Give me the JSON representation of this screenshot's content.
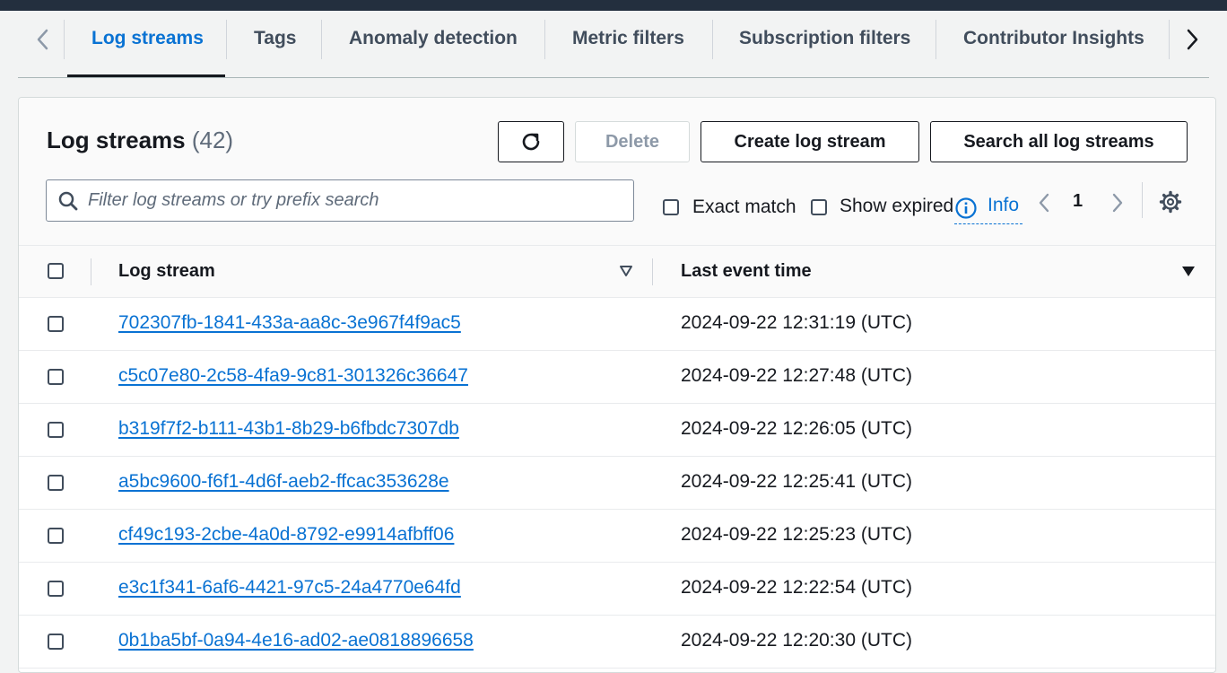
{
  "tabs": {
    "items": [
      "Log streams",
      "Tags",
      "Anomaly detection",
      "Metric filters",
      "Subscription filters",
      "Contributor Insights"
    ],
    "active": "Log streams"
  },
  "panel": {
    "title": "Log streams",
    "count": "(42)",
    "delete_label": "Delete",
    "create_label": "Create log stream",
    "search_all_label": "Search all log streams",
    "filter_placeholder": "Filter log streams or try prefix search",
    "exact_match_label": "Exact match",
    "show_expired_label": "Show expired",
    "info_label": "Info",
    "page": "1"
  },
  "table": {
    "columns": [
      "Log stream",
      "Last event time"
    ],
    "rows": [
      {
        "stream": "702307fb-1841-433a-aa8c-3e967f4f9ac5",
        "time": "2024-09-22 12:31:19 (UTC)"
      },
      {
        "stream": "c5c07e80-2c58-4fa9-9c81-301326c36647",
        "time": "2024-09-22 12:27:48 (UTC)"
      },
      {
        "stream": "b319f7f2-b111-43b1-8b29-b6fbdc7307db",
        "time": "2024-09-22 12:26:05 (UTC)"
      },
      {
        "stream": "a5bc9600-f6f1-4d6f-aeb2-ffcac353628e",
        "time": "2024-09-22 12:25:41 (UTC)"
      },
      {
        "stream": "cf49c193-2cbe-4a0d-8792-e9914afbff06",
        "time": "2024-09-22 12:25:23 (UTC)"
      },
      {
        "stream": "e3c1f341-6af6-4421-97c5-24a4770e64fd",
        "time": "2024-09-22 12:22:54 (UTC)"
      },
      {
        "stream": "0b1ba5bf-0a94-4e16-ad02-ae0818896658",
        "time": "2024-09-22 12:20:30 (UTC)"
      }
    ]
  },
  "icons": {
    "tab_prev": "chevron-left-icon",
    "tab_next": "chevron-right-icon",
    "refresh": "refresh-icon",
    "search": "search-icon",
    "info": "info-icon",
    "settings": "gear-icon",
    "sort_inactive": "sort-down-outline-icon",
    "sort_active": "sort-down-filled-icon"
  },
  "colors": {
    "link": "#0972d3",
    "text": "#16191f",
    "top_bar": "#232f3e",
    "page_bg": "#f2f3f3"
  }
}
